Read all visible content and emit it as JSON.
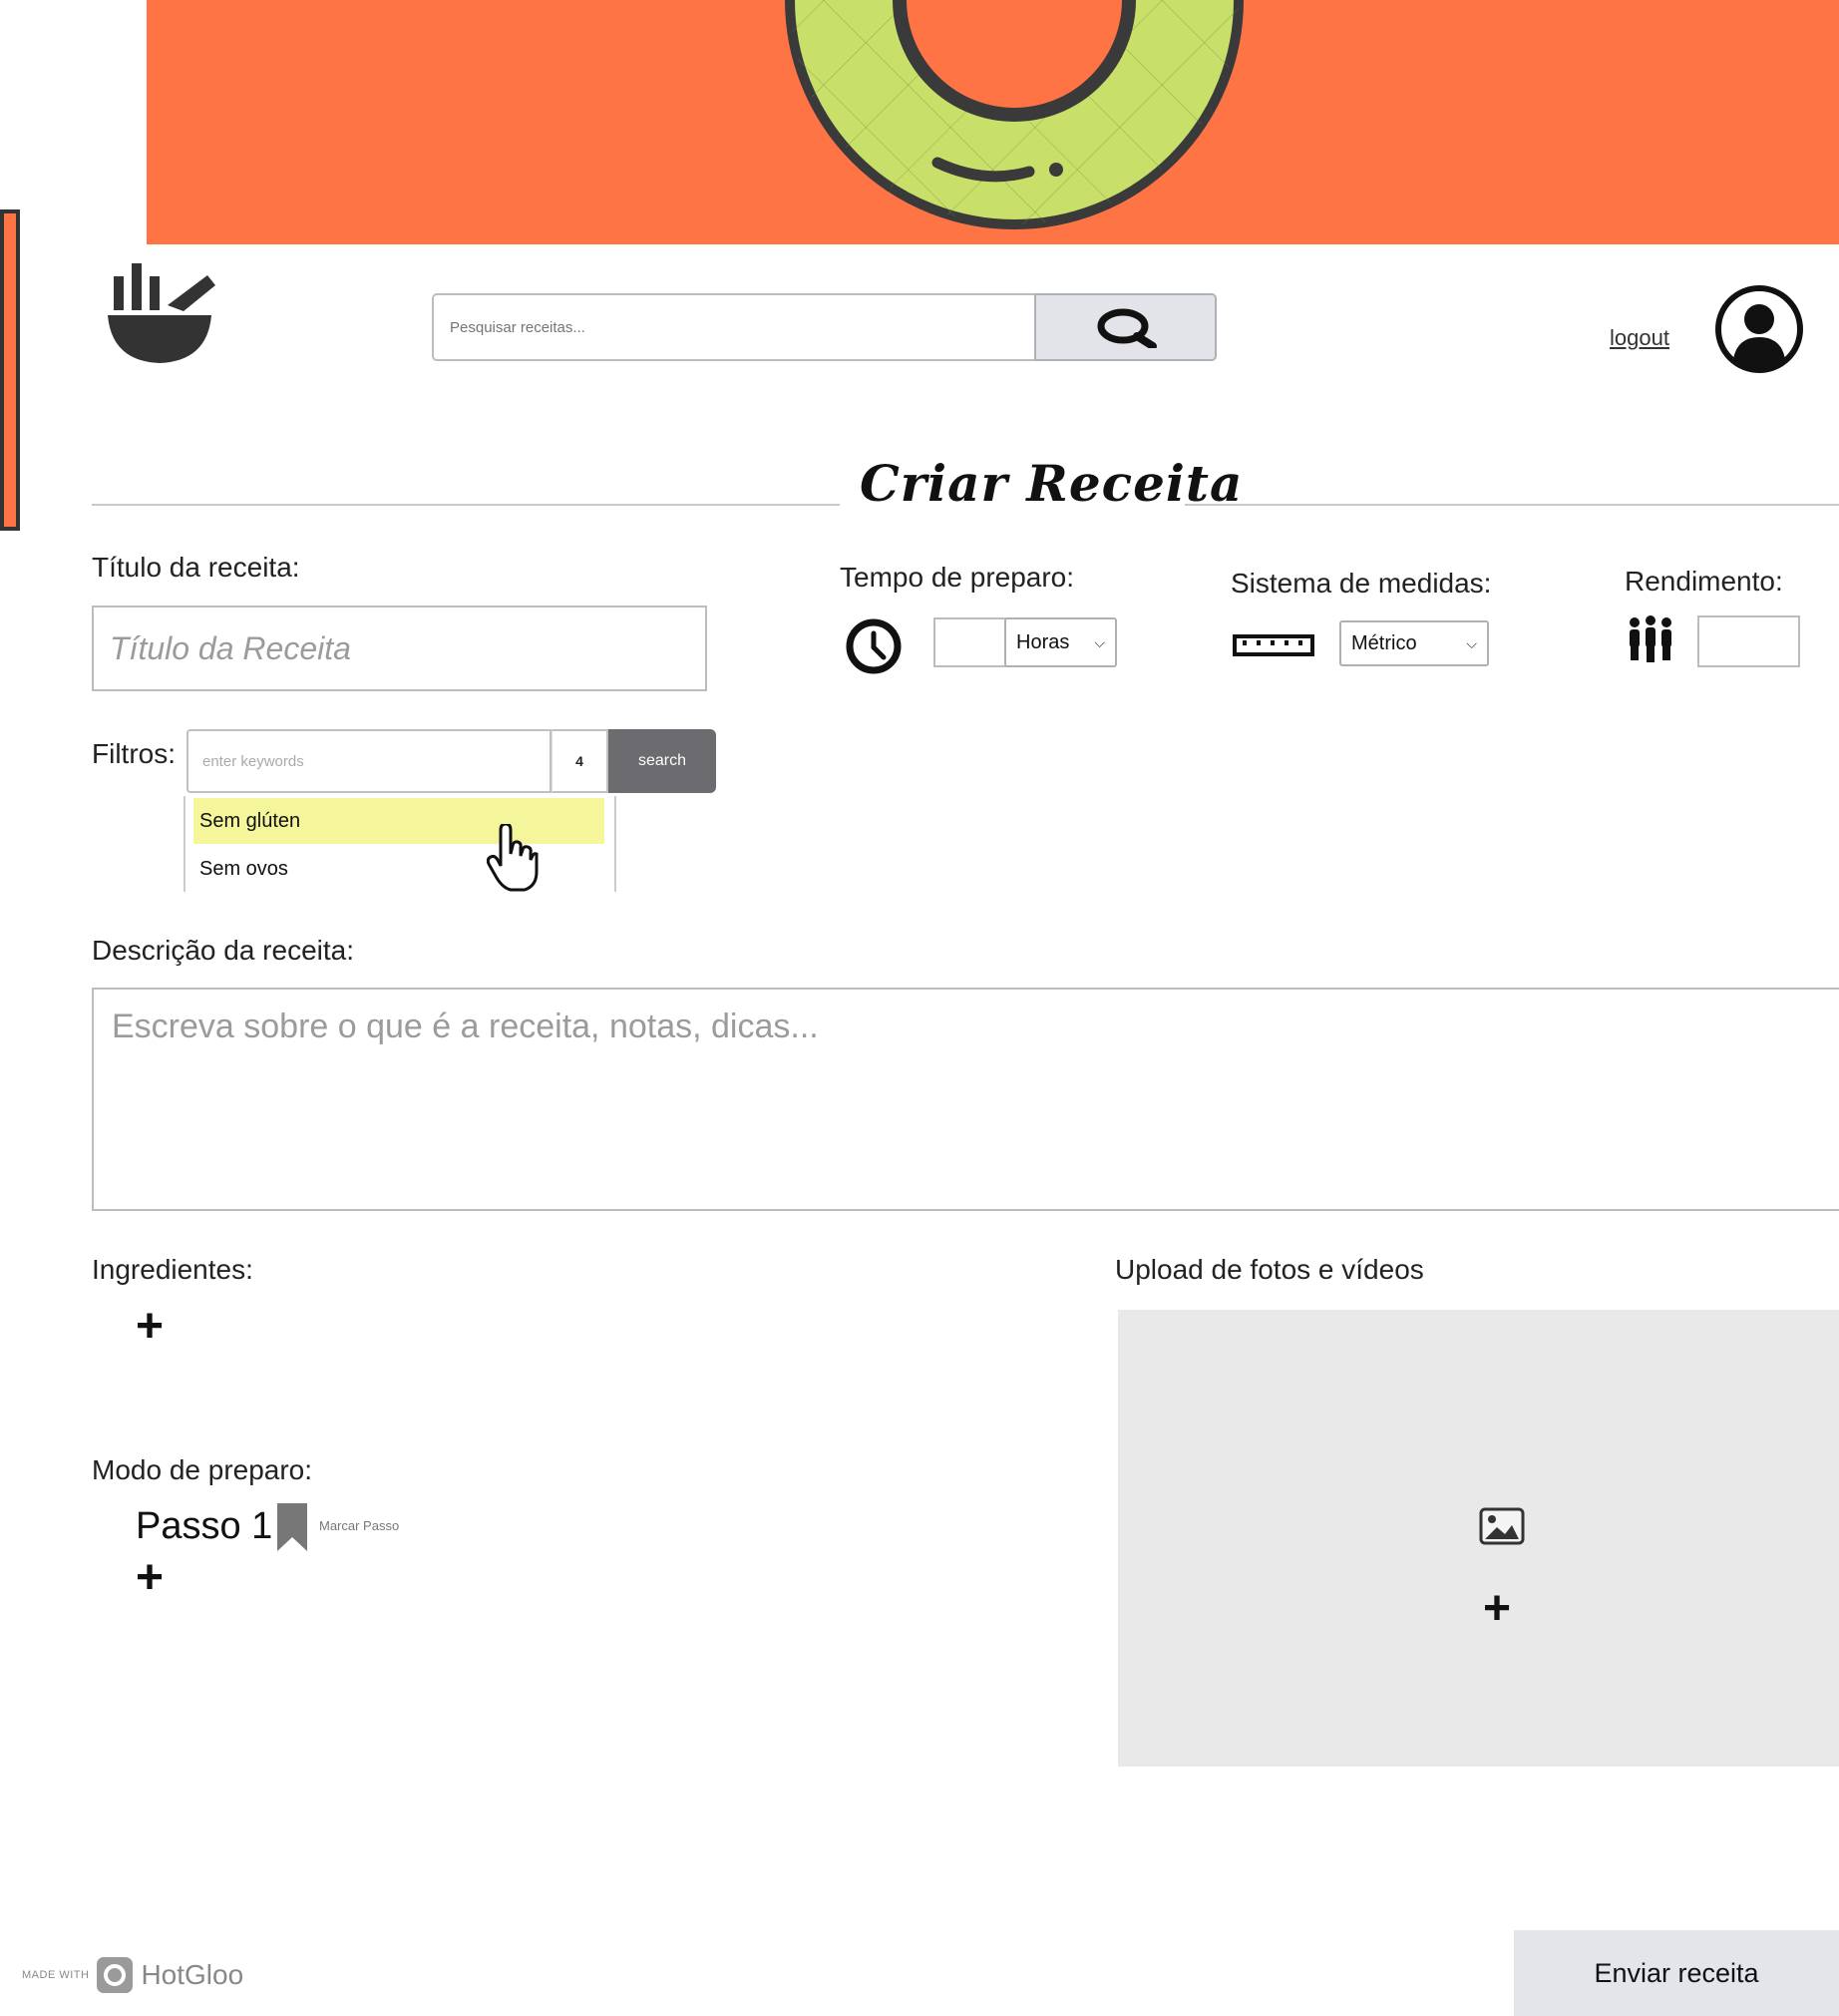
{
  "header": {
    "search_placeholder": "Pesquisar receitas...",
    "logout_label": "logout"
  },
  "page": {
    "title": "Criar Receita"
  },
  "form": {
    "title_label": "Título da receita:",
    "title_placeholder": "Título da Receita",
    "prep_time_label": "Tempo de preparo:",
    "prep_time_unit": "Horas",
    "measures_label": "Sistema de medidas:",
    "measures_value": "Métrico",
    "yield_label": "Rendimento:",
    "filters_label": "Filtros:",
    "filters_placeholder": "enter keywords",
    "filters_count": "4",
    "filters_button": "search",
    "filter_options": [
      "Sem glúten",
      "Sem ovos"
    ],
    "description_label": "Descrição da receita:",
    "description_placeholder": "Escreva sobre o que é a receita, notas, dicas...",
    "ingredients_label": "Ingredientes:",
    "method_label": "Modo de preparo:",
    "step_label": "Passo 1",
    "mark_step_label": "Marcar Passo",
    "upload_label": "Upload de fotos e vídeos",
    "submit_label": "Enviar receita"
  },
  "footer": {
    "made_with": "MADE WITH",
    "brand": "HotGloo"
  },
  "colors": {
    "banner": "#ff7445",
    "logo_green": "#c8e06a",
    "highlight": "#f5f59c",
    "button_gray": "#6b6b70"
  },
  "icons": [
    "bowl-logo-icon",
    "search-icon",
    "user-avatar-icon",
    "clock-icon",
    "ruler-icon",
    "people-icon",
    "hand-cursor-icon",
    "bookmark-icon",
    "plus-icon",
    "image-icon"
  ]
}
